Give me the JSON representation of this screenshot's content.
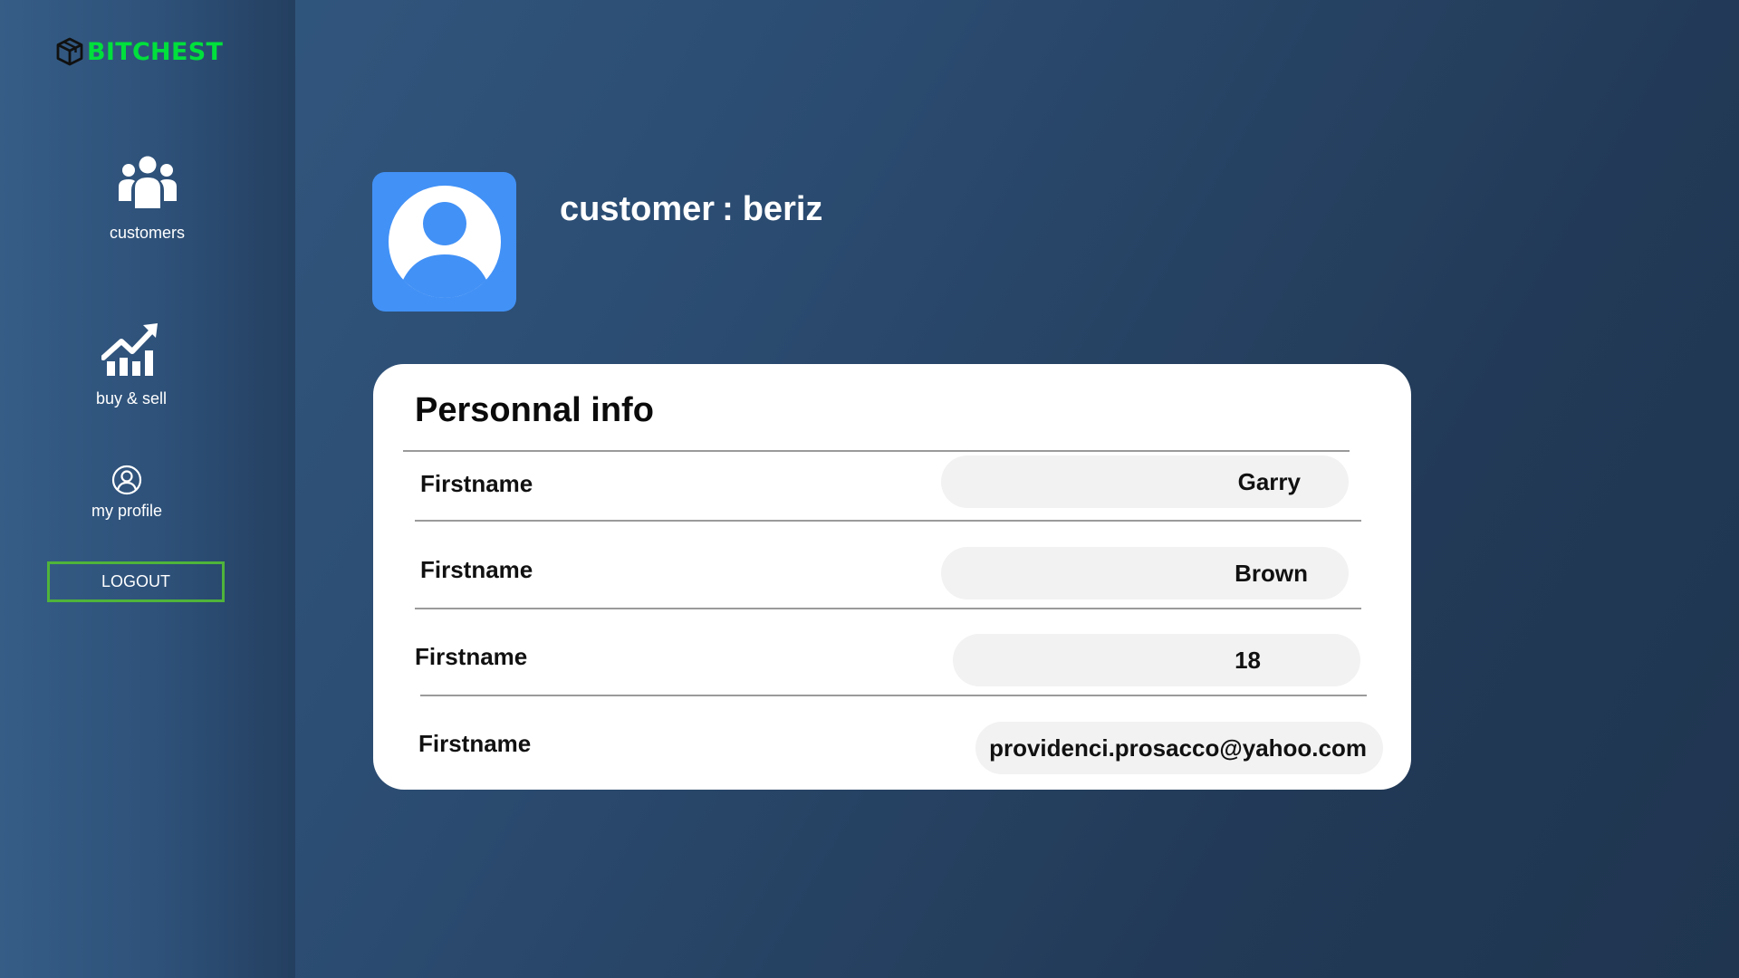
{
  "brand": {
    "name": "BITCHEST",
    "color": "#00e03c",
    "icon": "cube-icon"
  },
  "sidebar": {
    "items": [
      {
        "label": "customers",
        "icon": "users-icon"
      },
      {
        "label": "buy & sell",
        "icon": "chart-up-icon"
      },
      {
        "label": "my profile",
        "icon": "user-circle-icon"
      }
    ],
    "logout_label": "LOGOUT"
  },
  "header": {
    "prefix": "customer",
    "separator": ":",
    "username": "beriz",
    "avatar_icon": "user-avatar-icon",
    "avatar_color": "#4291f6"
  },
  "card": {
    "title": "Personnal info",
    "rows": [
      {
        "label": "Firstname",
        "value": "Garry"
      },
      {
        "label": "Firstname",
        "value": "Brown"
      },
      {
        "label": "Firstname",
        "value": "18"
      },
      {
        "label": "Firstname",
        "value": "providenci.prosacco@yahoo.com"
      }
    ]
  }
}
